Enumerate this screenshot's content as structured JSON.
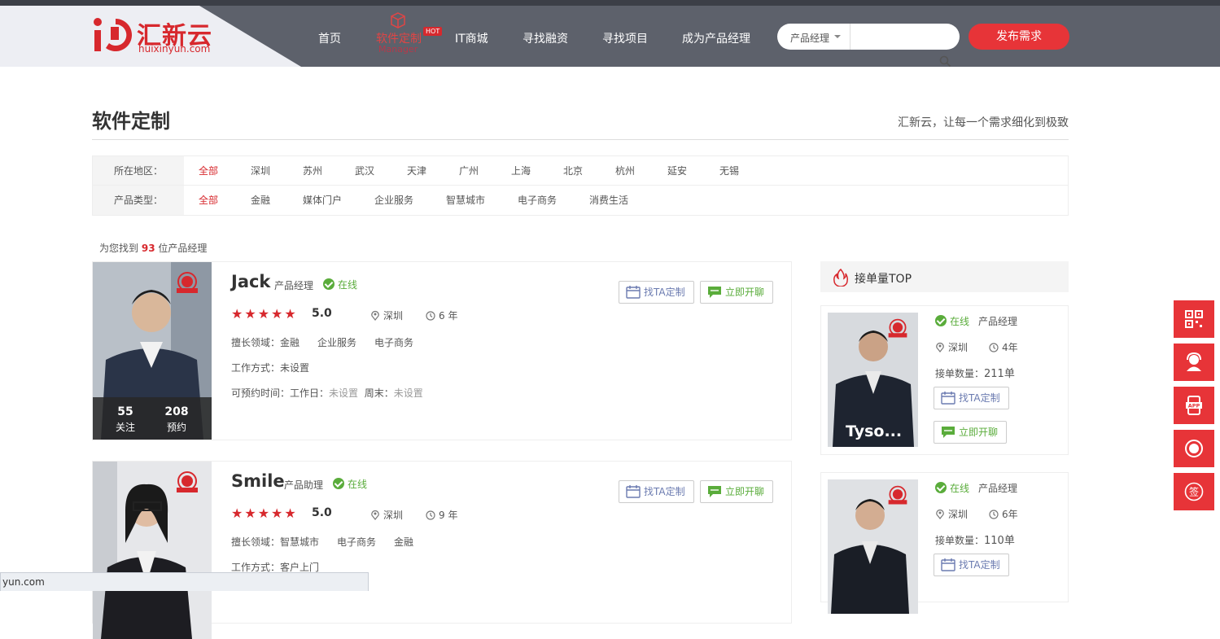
{
  "header": {
    "logo_cn": "汇新云",
    "logo_en": "huixinyun.com",
    "nav": [
      "首页",
      "软件定制",
      "IT商城",
      "寻找融资",
      "寻找项目",
      "成为产品经理"
    ],
    "nav_sub": "Manager",
    "hot": "HOT",
    "search_select": "产品经理",
    "search_placeholder": "",
    "publish": "发布需求"
  },
  "page": {
    "title": "软件定制",
    "slogan": "汇新云，让每一个需求细化到极致"
  },
  "filters": {
    "region_label": "所在地区：",
    "regions": [
      "全部",
      "深圳",
      "苏州",
      "武汉",
      "天津",
      "广州",
      "上海",
      "北京",
      "杭州",
      "延安",
      "无锡"
    ],
    "type_label": "产品类型：",
    "types": [
      "全部",
      "金融",
      "媒体门户",
      "企业服务",
      "智慧城市",
      "电子商务",
      "消费生活"
    ]
  },
  "results": {
    "prefix": "为您找到",
    "count": "93",
    "suffix": "位产品经理"
  },
  "cards": [
    {
      "name": "Jack",
      "role": "产品经理",
      "online": "在线",
      "stars": "★★★★★",
      "score": "5.0",
      "city": "深圳",
      "years": "6 年",
      "follow_n": "55",
      "follow_l": "关注",
      "book_n": "208",
      "book_l": "预约",
      "field_label": "擅长领域：",
      "fields": [
        "金融",
        "企业服务",
        "电子商务"
      ],
      "work_label": "工作方式：",
      "work": "未设置",
      "time_label": "可预约时间：",
      "workday_label": "工作日：",
      "workday": "未设置",
      "weekend_label": "周末：",
      "weekend": "未设置",
      "btn_custom": "找TA定制",
      "btn_chat": "立即开聊"
    },
    {
      "name": "Smile",
      "role": "产品助理",
      "online": "在线",
      "stars": "★★★★★",
      "score": "5.0",
      "city": "深圳",
      "years": "9 年",
      "field_label": "擅长领域：",
      "fields": [
        "智慧城市",
        "电子商务",
        "金融"
      ],
      "work_label": "工作方式：",
      "work": "客户上门",
      "btn_custom": "找TA定制",
      "btn_chat": "立即开聊"
    }
  ],
  "top": {
    "title": "接单量TOP",
    "items": [
      {
        "name": "Tyso...",
        "online": "在线",
        "role": "产品经理",
        "city": "深圳",
        "years": "4年",
        "count_label": "接单数量：",
        "count": "211单",
        "btn_custom": "找TA定制",
        "btn_chat": "立即开聊"
      },
      {
        "online": "在线",
        "role": "产品经理",
        "city": "深圳",
        "years": "6年",
        "count_label": "接单数量：",
        "count": "110单",
        "btn_custom": "找TA定制"
      }
    ]
  },
  "side_icons": [
    "qrcode-icon",
    "customer-service-icon",
    "app-icon",
    "record-icon",
    "sign-icon"
  ],
  "side_sign": "签",
  "side_app": "APP",
  "status_bar": "yun.com",
  "colors": {
    "brand_red": "#d7282d",
    "header_gray": "#5d616b",
    "online_green": "#5aac3b"
  }
}
